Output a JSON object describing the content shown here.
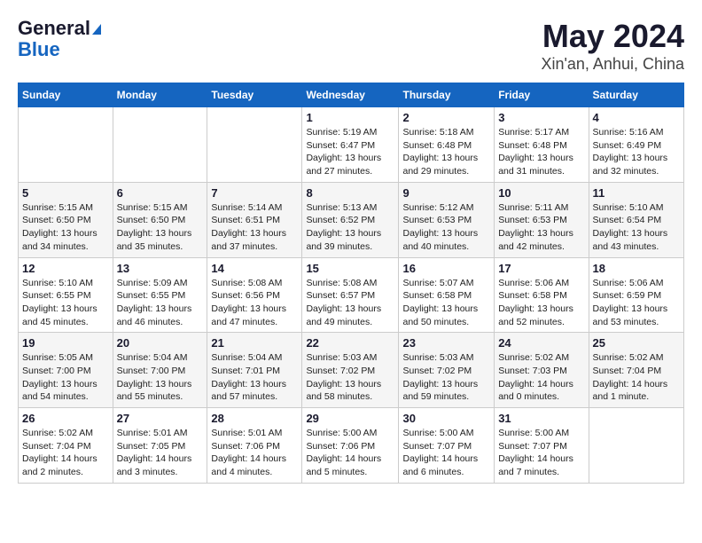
{
  "logo": {
    "general": "General",
    "blue": "Blue"
  },
  "title": "May 2024",
  "subtitle": "Xin'an, Anhui, China",
  "days": [
    "Sunday",
    "Monday",
    "Tuesday",
    "Wednesday",
    "Thursday",
    "Friday",
    "Saturday"
  ],
  "weeks": [
    [
      {
        "day": "",
        "info": ""
      },
      {
        "day": "",
        "info": ""
      },
      {
        "day": "",
        "info": ""
      },
      {
        "day": "1",
        "info": "Sunrise: 5:19 AM\nSunset: 6:47 PM\nDaylight: 13 hours and 27 minutes."
      },
      {
        "day": "2",
        "info": "Sunrise: 5:18 AM\nSunset: 6:48 PM\nDaylight: 13 hours and 29 minutes."
      },
      {
        "day": "3",
        "info": "Sunrise: 5:17 AM\nSunset: 6:48 PM\nDaylight: 13 hours and 31 minutes."
      },
      {
        "day": "4",
        "info": "Sunrise: 5:16 AM\nSunset: 6:49 PM\nDaylight: 13 hours and 32 minutes."
      }
    ],
    [
      {
        "day": "5",
        "info": "Sunrise: 5:15 AM\nSunset: 6:50 PM\nDaylight: 13 hours and 34 minutes."
      },
      {
        "day": "6",
        "info": "Sunrise: 5:15 AM\nSunset: 6:50 PM\nDaylight: 13 hours and 35 minutes."
      },
      {
        "day": "7",
        "info": "Sunrise: 5:14 AM\nSunset: 6:51 PM\nDaylight: 13 hours and 37 minutes."
      },
      {
        "day": "8",
        "info": "Sunrise: 5:13 AM\nSunset: 6:52 PM\nDaylight: 13 hours and 39 minutes."
      },
      {
        "day": "9",
        "info": "Sunrise: 5:12 AM\nSunset: 6:53 PM\nDaylight: 13 hours and 40 minutes."
      },
      {
        "day": "10",
        "info": "Sunrise: 5:11 AM\nSunset: 6:53 PM\nDaylight: 13 hours and 42 minutes."
      },
      {
        "day": "11",
        "info": "Sunrise: 5:10 AM\nSunset: 6:54 PM\nDaylight: 13 hours and 43 minutes."
      }
    ],
    [
      {
        "day": "12",
        "info": "Sunrise: 5:10 AM\nSunset: 6:55 PM\nDaylight: 13 hours and 45 minutes."
      },
      {
        "day": "13",
        "info": "Sunrise: 5:09 AM\nSunset: 6:55 PM\nDaylight: 13 hours and 46 minutes."
      },
      {
        "day": "14",
        "info": "Sunrise: 5:08 AM\nSunset: 6:56 PM\nDaylight: 13 hours and 47 minutes."
      },
      {
        "day": "15",
        "info": "Sunrise: 5:08 AM\nSunset: 6:57 PM\nDaylight: 13 hours and 49 minutes."
      },
      {
        "day": "16",
        "info": "Sunrise: 5:07 AM\nSunset: 6:58 PM\nDaylight: 13 hours and 50 minutes."
      },
      {
        "day": "17",
        "info": "Sunrise: 5:06 AM\nSunset: 6:58 PM\nDaylight: 13 hours and 52 minutes."
      },
      {
        "day": "18",
        "info": "Sunrise: 5:06 AM\nSunset: 6:59 PM\nDaylight: 13 hours and 53 minutes."
      }
    ],
    [
      {
        "day": "19",
        "info": "Sunrise: 5:05 AM\nSunset: 7:00 PM\nDaylight: 13 hours and 54 minutes."
      },
      {
        "day": "20",
        "info": "Sunrise: 5:04 AM\nSunset: 7:00 PM\nDaylight: 13 hours and 55 minutes."
      },
      {
        "day": "21",
        "info": "Sunrise: 5:04 AM\nSunset: 7:01 PM\nDaylight: 13 hours and 57 minutes."
      },
      {
        "day": "22",
        "info": "Sunrise: 5:03 AM\nSunset: 7:02 PM\nDaylight: 13 hours and 58 minutes."
      },
      {
        "day": "23",
        "info": "Sunrise: 5:03 AM\nSunset: 7:02 PM\nDaylight: 13 hours and 59 minutes."
      },
      {
        "day": "24",
        "info": "Sunrise: 5:02 AM\nSunset: 7:03 PM\nDaylight: 14 hours and 0 minutes."
      },
      {
        "day": "25",
        "info": "Sunrise: 5:02 AM\nSunset: 7:04 PM\nDaylight: 14 hours and 1 minute."
      }
    ],
    [
      {
        "day": "26",
        "info": "Sunrise: 5:02 AM\nSunset: 7:04 PM\nDaylight: 14 hours and 2 minutes."
      },
      {
        "day": "27",
        "info": "Sunrise: 5:01 AM\nSunset: 7:05 PM\nDaylight: 14 hours and 3 minutes."
      },
      {
        "day": "28",
        "info": "Sunrise: 5:01 AM\nSunset: 7:06 PM\nDaylight: 14 hours and 4 minutes."
      },
      {
        "day": "29",
        "info": "Sunrise: 5:00 AM\nSunset: 7:06 PM\nDaylight: 14 hours and 5 minutes."
      },
      {
        "day": "30",
        "info": "Sunrise: 5:00 AM\nSunset: 7:07 PM\nDaylight: 14 hours and 6 minutes."
      },
      {
        "day": "31",
        "info": "Sunrise: 5:00 AM\nSunset: 7:07 PM\nDaylight: 14 hours and 7 minutes."
      },
      {
        "day": "",
        "info": ""
      }
    ]
  ]
}
